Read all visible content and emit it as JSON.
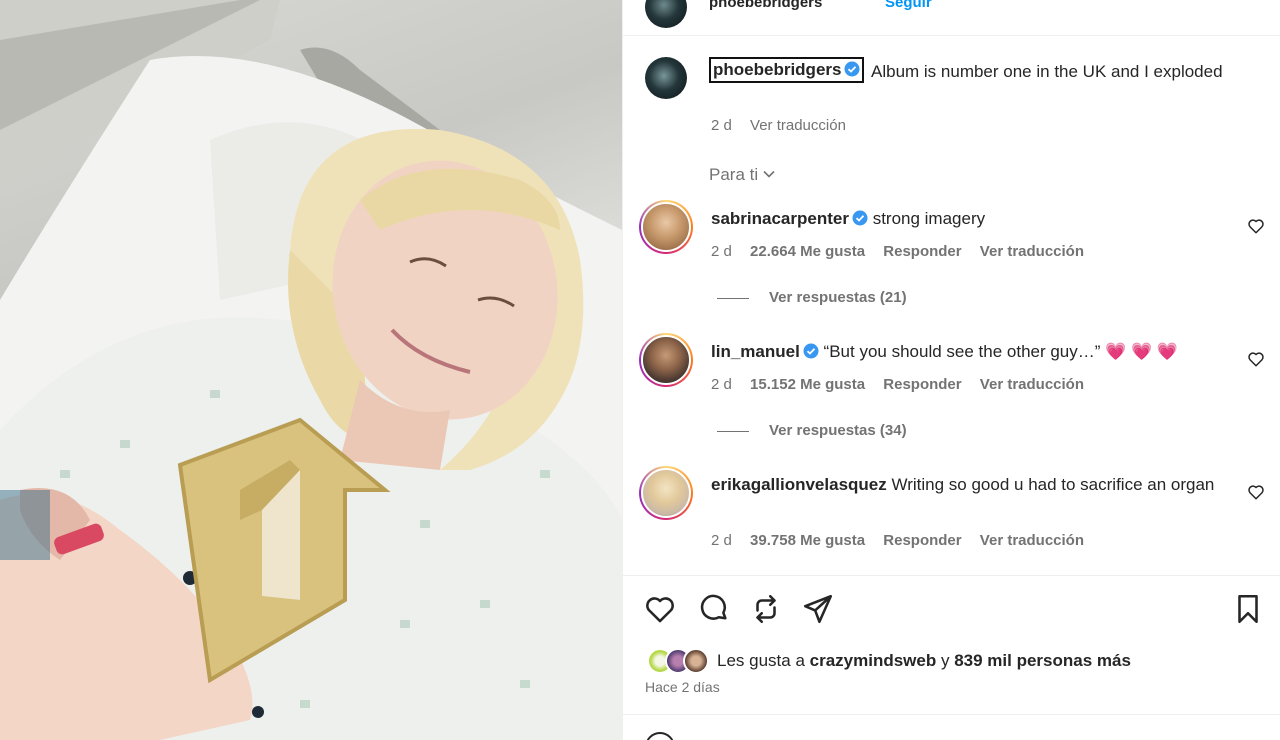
{
  "header": {
    "username": "phoebebridgers",
    "follow_label": "Seguir"
  },
  "caption": {
    "username": "phoebebridgers",
    "text": "Album is number one in the UK and I exploded",
    "time": "2 d",
    "translate": "Ver traducción"
  },
  "sort": {
    "label": "Para ti"
  },
  "comments": [
    {
      "username": "sabrinacarpenter",
      "verified": true,
      "text": "strong imagery",
      "time": "2 d",
      "likes": "22.664 Me gusta",
      "reply": "Responder",
      "translate": "Ver traducción",
      "view_replies": "Ver respuestas (21)"
    },
    {
      "username": "lin_manuel",
      "verified": true,
      "text": "“But you should see the other guy…” 💗 💗 💗",
      "time": "2 d",
      "likes": "15.152 Me gusta",
      "reply": "Responder",
      "translate": "Ver traducción",
      "view_replies": "Ver respuestas (34)"
    },
    {
      "username": "erikagallionvelasquez",
      "verified": false,
      "text": "Writing so good u had to sacrifice an organ",
      "time": "2 d",
      "likes": "39.758 Me gusta",
      "reply": "Responder",
      "translate": "Ver traducción"
    }
  ],
  "actions": {
    "icons": [
      "heart-icon",
      "comment-icon",
      "repost-icon",
      "share-icon",
      "bookmark-icon"
    ]
  },
  "likes": {
    "prefix": "Les gusta a",
    "user": "crazymindsweb",
    "connector": "y",
    "count": "839 mil personas más"
  },
  "posted": "Hace 2 días",
  "colors": {
    "link_blue": "#0095f6",
    "verified_blue": "#3897f0",
    "secondary_text": "#737373"
  }
}
